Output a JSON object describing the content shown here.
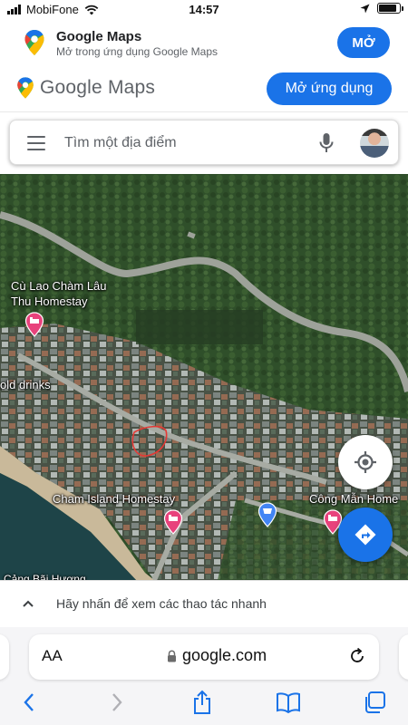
{
  "status_bar": {
    "carrier": "MobiFone",
    "time": "14:57",
    "battery_level": 0.85
  },
  "app_banner": {
    "title": "Google Maps",
    "subtitle": "Mở trong ứng dụng Google Maps",
    "open_label": "MỞ"
  },
  "header": {
    "logo_text": "Google Maps",
    "open_app_label": "Mở ứng dụng"
  },
  "search": {
    "placeholder": "Tìm một địa điểm"
  },
  "map": {
    "labels": {
      "cu_lao_line1": "Cù Lao Chàm Lâu",
      "cu_lao_line2": "Thu Homestay",
      "cold_drinks": "old drinks",
      "cham_island": "Cham Island Homestay",
      "cong_man": "Công Mẫn Home",
      "cang_bai_huong": "Cảng Bãi Hương"
    },
    "colors": {
      "lodging_pin": "#e8427c",
      "shop_pin": "#4285f4",
      "accent": "#1a73e8"
    }
  },
  "quick_actions": {
    "text": "Hãy nhấn để xem các thao tác nhanh"
  },
  "safari": {
    "aa_label": "AA",
    "url": "google.com"
  }
}
